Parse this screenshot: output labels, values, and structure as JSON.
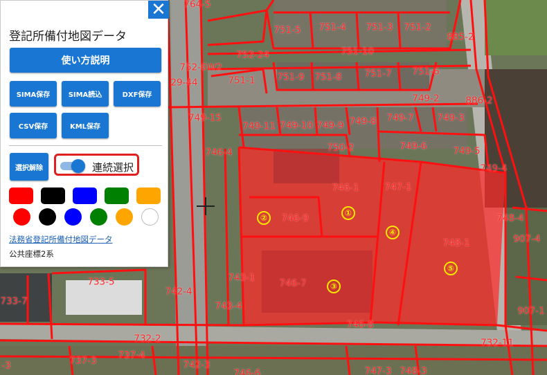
{
  "map": {
    "parcel_labels": [
      {
        "text": "764-5"
      },
      {
        "text": "751-5"
      },
      {
        "text": "751-4"
      },
      {
        "text": "751-3"
      },
      {
        "text": "751-2"
      },
      {
        "text": "885-2"
      },
      {
        "text": "752-24"
      },
      {
        "text": "751-10"
      },
      {
        "text": "752-6W2"
      },
      {
        "text": "751-9"
      },
      {
        "text": "751-8"
      },
      {
        "text": "751-7"
      },
      {
        "text": "751-6"
      },
      {
        "text": "751-1"
      },
      {
        "text": "29-44"
      },
      {
        "text": "749-2"
      },
      {
        "text": "886-2"
      },
      {
        "text": "749-15"
      },
      {
        "text": "749-11"
      },
      {
        "text": "749-10"
      },
      {
        "text": "749-9"
      },
      {
        "text": "749-8"
      },
      {
        "text": "749-7"
      },
      {
        "text": "749-3"
      },
      {
        "text": "750-2"
      },
      {
        "text": "749-6"
      },
      {
        "text": "749-5"
      },
      {
        "text": "746-4"
      },
      {
        "text": "749-4"
      },
      {
        "text": "746-1"
      },
      {
        "text": "747-1"
      },
      {
        "text": "746-9"
      },
      {
        "text": "748-4"
      },
      {
        "text": "907-4"
      },
      {
        "text": "748-1"
      },
      {
        "text": "743-1"
      },
      {
        "text": "733-5"
      },
      {
        "text": "746-7"
      },
      {
        "text": "742-4"
      },
      {
        "text": "733-7"
      },
      {
        "text": "743-4"
      },
      {
        "text": "907-1"
      },
      {
        "text": "746-8"
      },
      {
        "text": "732-2"
      },
      {
        "text": "732-11"
      },
      {
        "text": "737-3"
      },
      {
        "text": "737-4"
      },
      {
        "text": "742-3"
      },
      {
        "text": "747-3"
      },
      {
        "text": "748-3"
      },
      {
        "text": "746-6"
      },
      {
        "text": "-3"
      }
    ],
    "circled_numbers": [
      "①",
      "②",
      "③",
      "④",
      "⑤"
    ]
  },
  "panel": {
    "close_label": "✕",
    "title": "登記所備付地図データ",
    "manual_button": "使い方説明",
    "buttons": {
      "sima_save": "SIMA保存",
      "sima_read": "SIMA読込",
      "dxf_save": "DXF保存",
      "csv_save": "CSV保存",
      "kml_save": "KML保存",
      "deselect": "選択解除"
    },
    "toggle": {
      "label": "連続選択",
      "state": "on"
    },
    "swatch_colors": [
      "#ff0000",
      "#000000",
      "#0000ff",
      "#008000",
      "#ffa500"
    ],
    "dot_colors": [
      "#ff0000",
      "#000000",
      "#0000ff",
      "#008000",
      "#ffa500",
      "#ffffff"
    ],
    "link_text": "法務省登記所備付地図データ",
    "coord_system": "公共座標2系"
  }
}
